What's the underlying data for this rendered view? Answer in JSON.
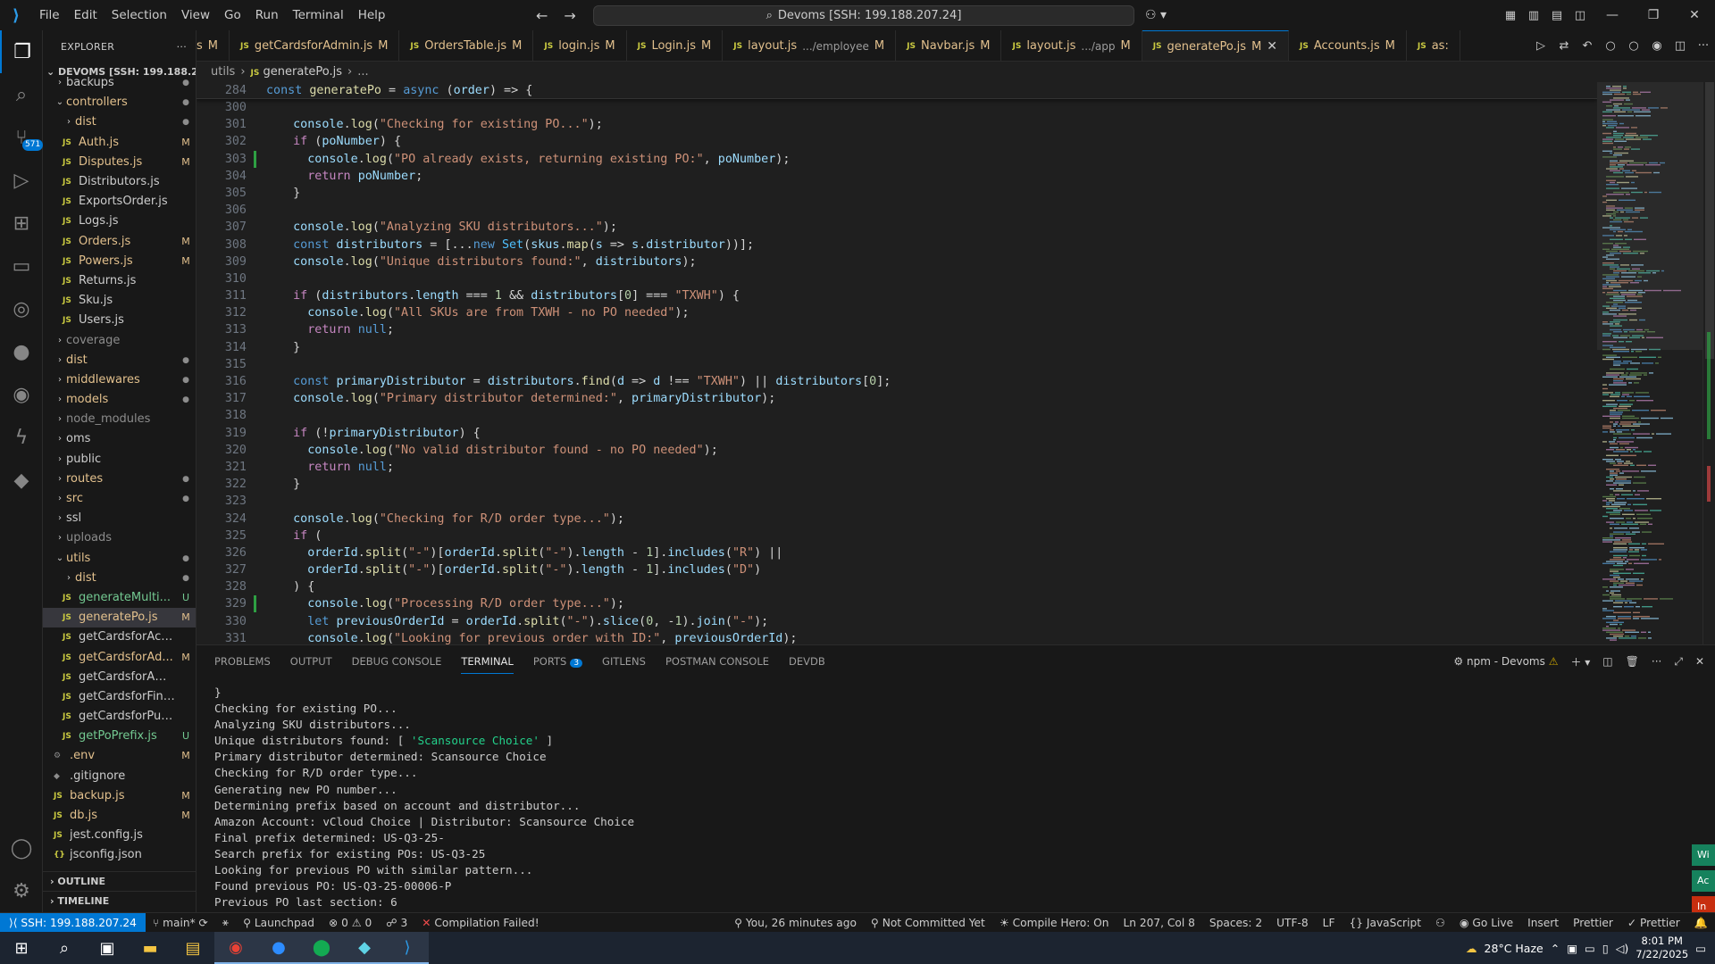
{
  "titlebar": {
    "menus": [
      "File",
      "Edit",
      "Selection",
      "View",
      "Go",
      "Run",
      "Terminal",
      "Help"
    ],
    "search_text": "Devoms [SSH: 199.188.207.24]"
  },
  "activity": {
    "scm_badge": "571"
  },
  "explorer": {
    "header": "EXPLORER",
    "root": "DEVOMS [SSH: 199.188.20...",
    "items": [
      {
        "indent": 1,
        "type": "folder",
        "open": false,
        "label": "backups",
        "status": "dot"
      },
      {
        "indent": 1,
        "type": "folder",
        "open": true,
        "label": "controllers",
        "status": "dot",
        "cls": "mod"
      },
      {
        "indent": 2,
        "type": "folder",
        "open": false,
        "label": "dist",
        "status": "dot",
        "cls": "mod"
      },
      {
        "indent": 2,
        "type": "js",
        "label": "Auth.js",
        "status": "M",
        "cls": "mod"
      },
      {
        "indent": 2,
        "type": "js",
        "label": "Disputes.js",
        "status": "M",
        "cls": "mod"
      },
      {
        "indent": 2,
        "type": "js",
        "label": "Distributors.js",
        "status": "",
        "cls": ""
      },
      {
        "indent": 2,
        "type": "js",
        "label": "ExportsOrder.js",
        "status": "",
        "cls": ""
      },
      {
        "indent": 2,
        "type": "js",
        "label": "Logs.js",
        "status": "",
        "cls": ""
      },
      {
        "indent": 2,
        "type": "js",
        "label": "Orders.js",
        "status": "M",
        "cls": "mod"
      },
      {
        "indent": 2,
        "type": "js",
        "label": "Powers.js",
        "status": "M",
        "cls": "mod"
      },
      {
        "indent": 2,
        "type": "js",
        "label": "Returns.js",
        "status": "",
        "cls": ""
      },
      {
        "indent": 2,
        "type": "js",
        "label": "Sku.js",
        "status": "",
        "cls": ""
      },
      {
        "indent": 2,
        "type": "js",
        "label": "Users.js",
        "status": "",
        "cls": ""
      },
      {
        "indent": 1,
        "type": "folder",
        "open": false,
        "label": "coverage",
        "status": "",
        "cls": "dim"
      },
      {
        "indent": 1,
        "type": "folder",
        "open": false,
        "label": "dist",
        "status": "dot",
        "cls": "mod"
      },
      {
        "indent": 1,
        "type": "folder",
        "open": false,
        "label": "middlewares",
        "status": "dot",
        "cls": "mod"
      },
      {
        "indent": 1,
        "type": "folder",
        "open": false,
        "label": "models",
        "status": "dot",
        "cls": "mod"
      },
      {
        "indent": 1,
        "type": "folder",
        "open": false,
        "label": "node_modules",
        "status": "",
        "cls": "dim"
      },
      {
        "indent": 1,
        "type": "folder",
        "open": false,
        "label": "oms",
        "status": "",
        "cls": ""
      },
      {
        "indent": 1,
        "type": "folder",
        "open": false,
        "label": "public",
        "status": "",
        "cls": ""
      },
      {
        "indent": 1,
        "type": "folder",
        "open": false,
        "label": "routes",
        "status": "dot",
        "cls": "mod"
      },
      {
        "indent": 1,
        "type": "folder",
        "open": false,
        "label": "src",
        "status": "dot",
        "cls": "mod"
      },
      {
        "indent": 1,
        "type": "folder",
        "open": false,
        "label": "ssl",
        "status": "",
        "cls": ""
      },
      {
        "indent": 1,
        "type": "folder",
        "open": false,
        "label": "uploads",
        "status": "",
        "cls": "dim"
      },
      {
        "indent": 1,
        "type": "folder",
        "open": true,
        "label": "utils",
        "status": "dot",
        "cls": "mod"
      },
      {
        "indent": 2,
        "type": "folder",
        "open": false,
        "label": "dist",
        "status": "dot",
        "cls": "mod"
      },
      {
        "indent": 2,
        "type": "js",
        "label": "generateMulti...",
        "status": "U",
        "cls": "untr"
      },
      {
        "indent": 2,
        "type": "js",
        "label": "generatePo.js",
        "status": "M",
        "cls": "mod",
        "selected": true
      },
      {
        "indent": 2,
        "type": "js",
        "label": "getCardsforAccount.js",
        "status": "",
        "cls": ""
      },
      {
        "indent": 2,
        "type": "js",
        "label": "getCardsforAd...",
        "status": "M",
        "cls": "mod"
      },
      {
        "indent": 2,
        "type": "js",
        "label": "getCardsforAmazon.js",
        "status": "",
        "cls": ""
      },
      {
        "indent": 2,
        "type": "js",
        "label": "getCardsforFinance.js",
        "status": "",
        "cls": ""
      },
      {
        "indent": 2,
        "type": "js",
        "label": "getCardsforPurchasi...",
        "status": "",
        "cls": ""
      },
      {
        "indent": 2,
        "type": "js",
        "label": "getPoPrefix.js",
        "status": "U",
        "cls": "untr"
      },
      {
        "indent": 1,
        "type": "gear",
        "label": ".env",
        "status": "M",
        "cls": "mod"
      },
      {
        "indent": 1,
        "type": "git",
        "label": ".gitignore",
        "status": "",
        "cls": ""
      },
      {
        "indent": 1,
        "type": "js",
        "label": "backup.js",
        "status": "M",
        "cls": "mod"
      },
      {
        "indent": 1,
        "type": "js",
        "label": "db.js",
        "status": "M",
        "cls": "mod"
      },
      {
        "indent": 1,
        "type": "js",
        "label": "jest.config.js",
        "status": "",
        "cls": ""
      },
      {
        "indent": 1,
        "type": "json",
        "label": "jsconfig.json",
        "status": "",
        "cls": ""
      }
    ],
    "outline": "OUTLINE",
    "timeline": "TIMELINE"
  },
  "tabs": [
    {
      "label": "s",
      "sub": "",
      "status": "M"
    },
    {
      "label": "getCardsforAdmin.js",
      "sub": "",
      "status": "M"
    },
    {
      "label": "OrdersTable.js",
      "sub": "",
      "status": "M"
    },
    {
      "label": "login.js",
      "sub": "",
      "status": "M"
    },
    {
      "label": "Login.js",
      "sub": "",
      "status": "M"
    },
    {
      "label": "layout.js",
      "sub": ".../employee",
      "status": "M"
    },
    {
      "label": "Navbar.js",
      "sub": "",
      "status": "M"
    },
    {
      "label": "layout.js",
      "sub": ".../app",
      "status": "M"
    },
    {
      "label": "generatePo.js",
      "sub": "",
      "status": "M",
      "active": true
    },
    {
      "label": "Accounts.js",
      "sub": "",
      "status": "M"
    },
    {
      "label": "as:",
      "sub": "",
      "status": ""
    }
  ],
  "breadcrumb": [
    "utils",
    "generatePo.js",
    "..."
  ],
  "sticky_line": {
    "num": "284",
    "code": "const generatePo = async (order) => {"
  },
  "code_lines": [
    {
      "n": "300",
      "t": "",
      "g": false
    },
    {
      "n": "301",
      "t": "  console.log(\"Checking for existing PO...\");",
      "g": false
    },
    {
      "n": "302",
      "t": "  if (poNumber) {",
      "g": false
    },
    {
      "n": "303",
      "t": "    console.log(\"PO already exists, returning existing PO:\", poNumber);",
      "g": true
    },
    {
      "n": "304",
      "t": "    return poNumber;",
      "g": false
    },
    {
      "n": "305",
      "t": "  }",
      "g": false
    },
    {
      "n": "306",
      "t": "",
      "g": false
    },
    {
      "n": "307",
      "t": "  console.log(\"Analyzing SKU distributors...\");",
      "g": false
    },
    {
      "n": "308",
      "t": "  const distributors = [...new Set(skus.map(s => s.distributor))];",
      "g": false
    },
    {
      "n": "309",
      "t": "  console.log(\"Unique distributors found:\", distributors);",
      "g": false
    },
    {
      "n": "310",
      "t": "",
      "g": false
    },
    {
      "n": "311",
      "t": "  if (distributors.length === 1 && distributors[0] === \"TXWH\") {",
      "g": false
    },
    {
      "n": "312",
      "t": "    console.log(\"All SKUs are from TXWH - no PO needed\");",
      "g": false
    },
    {
      "n": "313",
      "t": "    return null;",
      "g": false
    },
    {
      "n": "314",
      "t": "  }",
      "g": false
    },
    {
      "n": "315",
      "t": "",
      "g": false
    },
    {
      "n": "316",
      "t": "  const primaryDistributor = distributors.find(d => d !== \"TXWH\") || distributors[0];",
      "g": false
    },
    {
      "n": "317",
      "t": "  console.log(\"Primary distributor determined:\", primaryDistributor);",
      "g": false
    },
    {
      "n": "318",
      "t": "",
      "g": false
    },
    {
      "n": "319",
      "t": "  if (!primaryDistributor) {",
      "g": false
    },
    {
      "n": "320",
      "t": "    console.log(\"No valid distributor found - no PO needed\");",
      "g": false
    },
    {
      "n": "321",
      "t": "    return null;",
      "g": false
    },
    {
      "n": "322",
      "t": "  }",
      "g": false
    },
    {
      "n": "323",
      "t": "",
      "g": false
    },
    {
      "n": "324",
      "t": "  console.log(\"Checking for R/D order type...\");",
      "g": false
    },
    {
      "n": "325",
      "t": "  if (",
      "g": false
    },
    {
      "n": "326",
      "t": "    orderId.split(\"-\")[orderId.split(\"-\").length - 1].includes(\"R\") ||",
      "g": false
    },
    {
      "n": "327",
      "t": "    orderId.split(\"-\")[orderId.split(\"-\").length - 1].includes(\"D\")",
      "g": false
    },
    {
      "n": "328",
      "t": "  ) {",
      "g": false
    },
    {
      "n": "329",
      "t": "    console.log(\"Processing R/D order type...\");",
      "g": true
    },
    {
      "n": "330",
      "t": "    let previousOrderId = orderId.split(\"-\").slice(0, -1).join(\"-\");",
      "g": false
    },
    {
      "n": "331",
      "t": "    console.log(\"Looking for previous order with ID:\", previousOrderId);",
      "g": false
    }
  ],
  "panel": {
    "tabs": [
      "PROBLEMS",
      "OUTPUT",
      "DEBUG CONSOLE",
      "TERMINAL",
      "PORTS",
      "GITLENS",
      "POSTMAN CONSOLE",
      "DEVDB"
    ],
    "ports_badge": "3",
    "terminal_name": "npm - Devoms",
    "lines": [
      "}",
      "Checking for existing PO...",
      "Analyzing SKU distributors...",
      "Unique distributors found: [ 'Scansource Choice' ]",
      "Primary distributor determined: Scansource Choice",
      "Checking for R/D order type...",
      "Generating new PO number...",
      "Determining prefix based on account and distributor...",
      "Amazon Account: vCloud Choice | Distributor: Scansource Choice",
      "Final prefix determined: US-Q3-25-",
      "Search prefix for existing POs: US-Q3-25",
      "Looking for previous PO with similar pattern...",
      "Found previous PO: US-Q3-25-00006-P",
      "Previous PO last section: 6"
    ]
  },
  "status": {
    "remote": "SSH: 199.188.207.24",
    "branch": "main*",
    "launchpad": "Launchpad",
    "errors": "0",
    "warnings": "0",
    "ports": "3",
    "compile": "Compilation Failed!",
    "blame": "You, 26 minutes ago",
    "commit": "Not Committed Yet",
    "compile_hero": "Compile Hero: On",
    "position": "Ln 207, Col 8",
    "spaces": "Spaces: 2",
    "encoding": "UTF-8",
    "eol": "LF",
    "language": "JavaScript",
    "golive": "Go Live",
    "insert": "Insert",
    "prettier1": "Prettier",
    "prettier2": "Prettier"
  },
  "taskbar": {
    "weather": "28°C Haze",
    "time": "8:01 PM",
    "date": "7/22/2025"
  },
  "toasts": [
    "Wi",
    "Ac",
    "In"
  ]
}
